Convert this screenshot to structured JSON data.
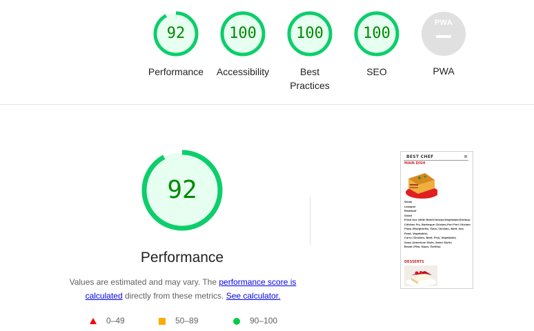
{
  "categories": [
    {
      "label": "Performance",
      "score": "92",
      "score_value": 92
    },
    {
      "label": "Accessibility",
      "score": "100",
      "score_value": 100
    },
    {
      "label": "Best Practices",
      "score": "100",
      "score_value": 100
    },
    {
      "label": "SEO",
      "score": "100",
      "score_value": 100
    },
    {
      "label": "PWA",
      "badge": "PWA"
    }
  ],
  "main": {
    "score": "92",
    "score_value": 92,
    "title": "Performance",
    "desc_prefix": "Values are estimated and may vary. The ",
    "link_score": "performance score is calculated",
    "desc_middle": " directly from these metrics. ",
    "link_calc": "See calculator."
  },
  "legend": [
    {
      "range": "0–49",
      "shape": "triangle",
      "color": "#ff0000"
    },
    {
      "range": "50–89",
      "shape": "square",
      "color": "#ffaa00"
    },
    {
      "range": "90–100",
      "shape": "circle",
      "color": "#00cc44"
    }
  ],
  "screenshot": {
    "header": "BEST CHEF",
    "menu_glyph": "≡",
    "section1": "MAIN DISH",
    "items": [
      "Steak",
      "Lasagne",
      "Meatloaf",
      "Salad",
      "Fried rice (With Beef/Chicken/Vegetable/Shrimp)",
      "Chicken Fry, Barbeque Chicken,Peri Peri Chicken",
      "Pizza (Margherita, Tuna, Chicken, Beef, Sea Food, Vegetable)",
      "Curry (Chicken, Beef, Fish, Vegetable)",
      "Soup (American Style, Asian Style)",
      "Bread (Pita, Naan, Tortilla)"
    ],
    "section2": "DESSERTS"
  },
  "colors": {
    "pass": "#0cce6b",
    "pass_fill": "#e6fff0",
    "pass_text": "#008800",
    "pwa_grey": "#e0e0e0"
  }
}
